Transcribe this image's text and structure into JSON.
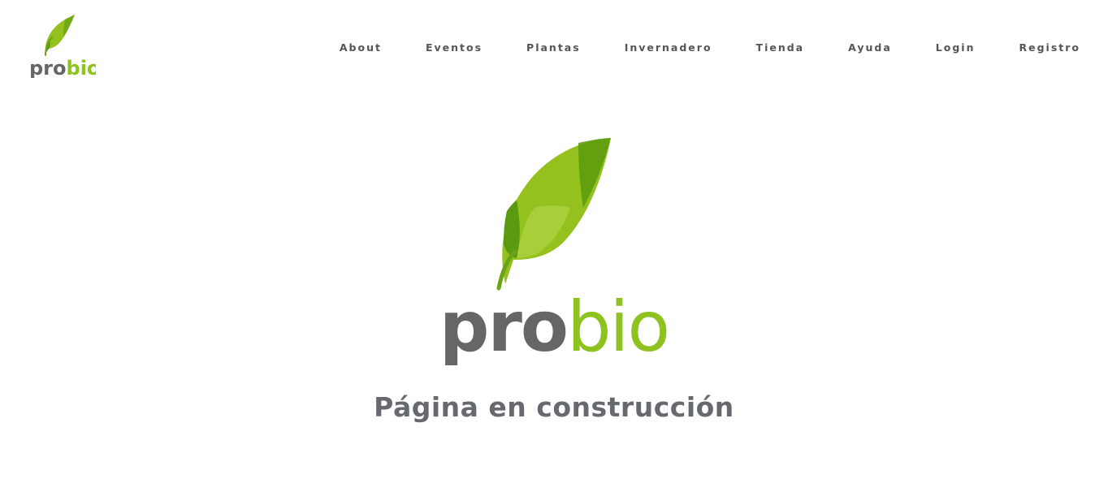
{
  "brand": {
    "logo_text_dark": "pro",
    "logo_text_green": "bio",
    "colors": {
      "gray": "#666666",
      "green": "#8dc21f",
      "dark_green": "#5a9a0e"
    }
  },
  "nav": {
    "items": [
      {
        "label": "About"
      },
      {
        "label": "Eventos"
      },
      {
        "label": "Plantas"
      },
      {
        "label": "Invernadero"
      },
      {
        "label": "Tienda"
      },
      {
        "label": "Ayuda"
      },
      {
        "label": "Login"
      },
      {
        "label": "Registro"
      }
    ]
  },
  "hero": {
    "logo_text_dark": "pro",
    "logo_text_green": "bio",
    "title": "Página en construcción"
  }
}
